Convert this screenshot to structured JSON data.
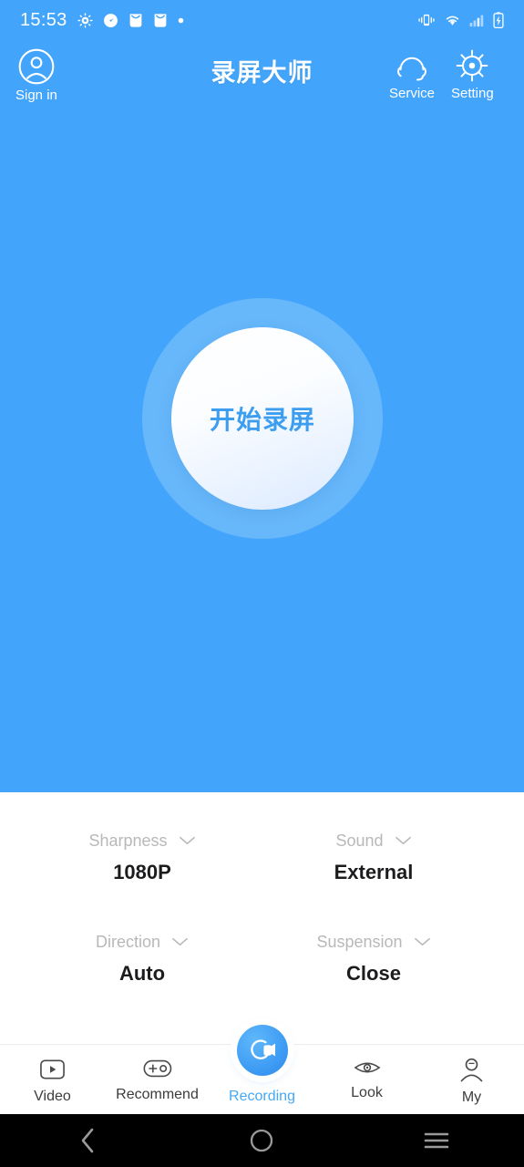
{
  "status_bar": {
    "time": "15:53",
    "left_icons": [
      "settings-gear-icon",
      "speedometer-icon",
      "mail-icon",
      "mail-icon",
      "dot-icon"
    ],
    "right_icons": [
      "vibrate-icon",
      "wifi-icon",
      "cellular-signal-icon",
      "battery-charging-icon"
    ]
  },
  "app_bar": {
    "title": "录屏大师",
    "sign_in": {
      "label": "Sign in",
      "icon": "user-circle-icon"
    },
    "service": {
      "label": "Service",
      "icon": "headset-icon"
    },
    "setting": {
      "label": "Setting",
      "icon": "gear-icon"
    }
  },
  "record": {
    "button_text": "开始录屏"
  },
  "settings": {
    "items": [
      {
        "label": "Sharpness",
        "value": "1080P",
        "chevron": "chevron-down-icon"
      },
      {
        "label": "Sound",
        "value": "External",
        "chevron": "chevron-down-icon"
      },
      {
        "label": "Direction",
        "value": "Auto",
        "chevron": "chevron-down-icon"
      },
      {
        "label": "Suspension",
        "value": "Close",
        "chevron": "chevron-down-icon"
      }
    ]
  },
  "tabbar": {
    "items": [
      {
        "label": "Video",
        "icon": "video-play-icon",
        "active": false
      },
      {
        "label": "Recommend",
        "icon": "plus-circle-pill-icon",
        "active": false
      },
      {
        "label": "Recording",
        "icon": "record-camera-icon",
        "active": true
      },
      {
        "label": "Look",
        "icon": "eye-icon",
        "active": false
      },
      {
        "label": "My",
        "icon": "person-icon",
        "active": false
      }
    ]
  },
  "nav_bar": {
    "back": "back-chevron-icon",
    "home": "home-circle-icon",
    "recents": "recents-menu-icon"
  },
  "colors": {
    "brand_blue": "#42a5fb",
    "accent_blue": "#46a8f5",
    "value_text": "#1c1c1e",
    "label_gray": "#b8b8bb",
    "nav_black": "#000000"
  }
}
